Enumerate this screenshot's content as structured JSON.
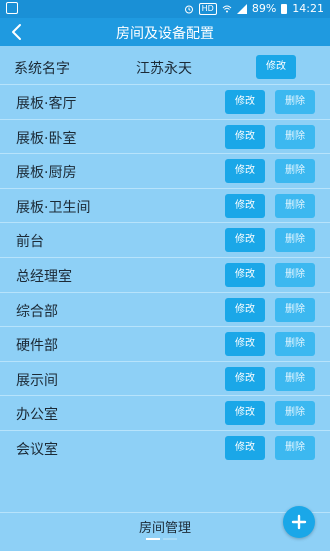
{
  "status_bar": {
    "hd_label": "HD",
    "battery": "89%",
    "time": "14:21"
  },
  "app_bar": {
    "title": "房间及设备配置"
  },
  "system": {
    "label": "系统名字",
    "name": "江苏永天",
    "edit_label": "修改"
  },
  "rooms": [
    {
      "name": "展板·客厅",
      "edit_label": "修改",
      "delete_label": "删除"
    },
    {
      "name": "展板·卧室",
      "edit_label": "修改",
      "delete_label": "删除"
    },
    {
      "name": "展板·厨房",
      "edit_label": "修改",
      "delete_label": "删除"
    },
    {
      "name": "展板·卫生间",
      "edit_label": "修改",
      "delete_label": "删除"
    },
    {
      "name": "前台",
      "edit_label": "修改",
      "delete_label": "删除"
    },
    {
      "name": "总经理室",
      "edit_label": "修改",
      "delete_label": "删除"
    },
    {
      "name": "综合部",
      "edit_label": "修改",
      "delete_label": "删除"
    },
    {
      "name": "硬件部",
      "edit_label": "修改",
      "delete_label": "删除"
    },
    {
      "name": "展示间",
      "edit_label": "修改",
      "delete_label": "删除"
    },
    {
      "name": "办公室",
      "edit_label": "修改",
      "delete_label": "删除"
    },
    {
      "name": "会议室",
      "edit_label": "修改",
      "delete_label": "删除"
    }
  ],
  "bottom": {
    "title": "房间管理"
  }
}
